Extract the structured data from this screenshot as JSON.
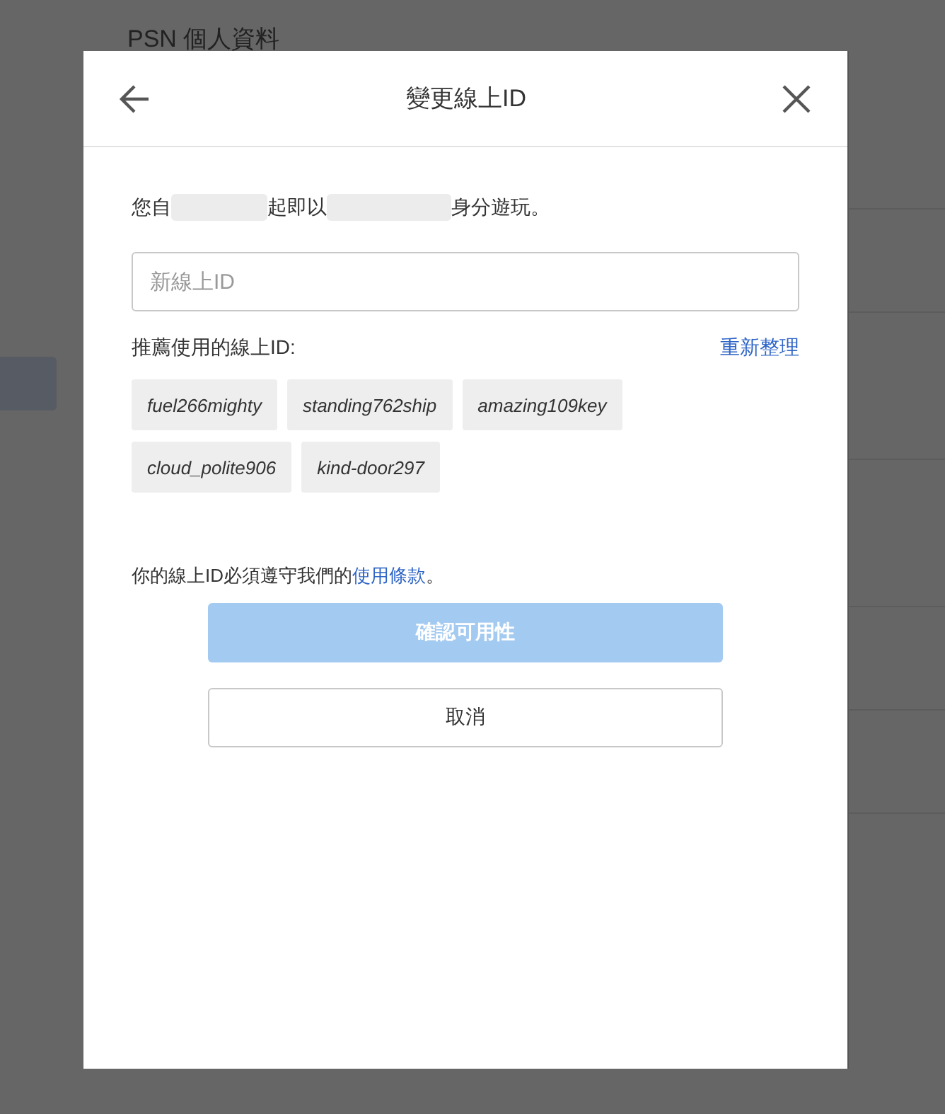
{
  "background_page": {
    "title": "PSN 個人資料"
  },
  "dialog": {
    "title": "變更線上ID",
    "intro": [
      {
        "kind": "text",
        "text": "您自"
      },
      {
        "kind": "blurred"
      },
      {
        "kind": "text",
        "text": "起即以"
      },
      {
        "kind": "blurred"
      },
      {
        "kind": "text",
        "text": "身分遊玩。"
      }
    ],
    "new_id_field": {
      "placeholder": "新線上ID"
    },
    "suggestions_label": "推薦使用的線上ID:",
    "refresh_link": "重新整理",
    "suggestions": [
      {
        "label": "fuel266mighty"
      },
      {
        "label": "standing762ship"
      },
      {
        "label": "amazing109key"
      },
      {
        "label": "cloud_polite906"
      },
      {
        "label": "kind-door297"
      }
    ],
    "terms": {
      "text_before": "你的線上ID必須遵守我們的",
      "link": "使用條款",
      "text_after": "。"
    },
    "buttons": [
      {
        "label": "確認可用性",
        "kind": "primary",
        "disabled": true
      },
      {
        "label": "取消",
        "kind": "secondary",
        "disabled": false
      }
    ]
  }
}
